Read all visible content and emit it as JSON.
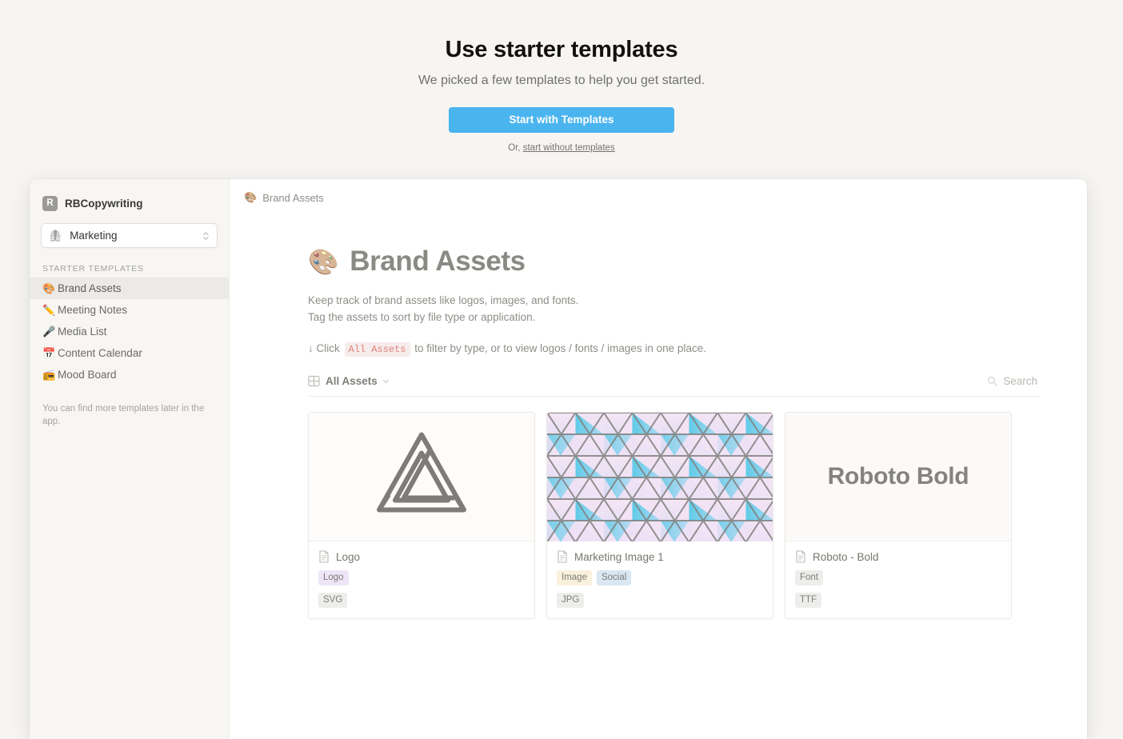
{
  "promo": {
    "title": "Use starter templates",
    "subtitle": "We picked a few templates to help you get started.",
    "primary_button": "Start with Templates",
    "alt_prefix": "Or, ",
    "alt_link": "start without templates"
  },
  "sidebar": {
    "workspace_initial": "R",
    "workspace_name": "RBCopywriting",
    "selector": {
      "emoji": "🦺",
      "label": "Marketing",
      "icon": "chevron-up-down-icon"
    },
    "section_title": "STARTER TEMPLATES",
    "items": [
      {
        "emoji": "🎨",
        "label": "Brand Assets",
        "active": true
      },
      {
        "emoji": "✏️",
        "label": "Meeting Notes",
        "active": false
      },
      {
        "emoji": "🎤",
        "label": "Media List",
        "active": false
      },
      {
        "emoji": "📅",
        "label": "Content Calendar",
        "active": false
      },
      {
        "emoji": "📻",
        "label": "Mood Board",
        "active": false
      }
    ],
    "note": "You can find more templates later in the app."
  },
  "content": {
    "breadcrumb": {
      "emoji": "🎨",
      "label": "Brand Assets"
    },
    "page_emoji": "🎨",
    "page_title": "Brand Assets",
    "description_line1": "Keep track of brand assets like logos, images, and fonts.",
    "description_line2": "Tag the assets to sort by file type or application.",
    "hint_before": "↓ Click ",
    "hint_code": "All Assets",
    "hint_after": " to filter by type, or to view logos / fonts / images in one place.",
    "toolbar": {
      "view_icon": "gallery-grid-icon",
      "view_label": "All Assets",
      "view_chevron": "chevron-down-icon",
      "search_icon": "search-icon",
      "search_placeholder": "Search"
    },
    "cards": [
      {
        "media_type": "logo",
        "title": "Logo",
        "tags": [
          {
            "label": "Logo",
            "bg": "#eee6f6",
            "color": "#7c7b76"
          },
          {
            "label": "SVG",
            "bg": "#ededeb",
            "color": "#7c7b76"
          }
        ]
      },
      {
        "media_type": "pattern",
        "title": "Marketing Image 1",
        "tags": [
          {
            "label": "Image",
            "bg": "#faf1dd",
            "color": "#7c7b76"
          },
          {
            "label": "Social",
            "bg": "#d9e8f3",
            "color": "#7c7b76"
          },
          {
            "label": "JPG",
            "bg": "#ededeb",
            "color": "#7c7b76"
          }
        ]
      },
      {
        "media_type": "font",
        "media_text": "Roboto Bold",
        "title": "Roboto - Bold",
        "tags": [
          {
            "label": "Font",
            "bg": "#ededeb",
            "color": "#7c7b76"
          },
          {
            "label": "TTF",
            "bg": "#ededeb",
            "color": "#7c7b76"
          }
        ]
      }
    ]
  },
  "colors": {
    "accent": "#4ab4ef",
    "page_bg": "#f6f5f1",
    "sidebar_bg": "#f7f6f3"
  }
}
